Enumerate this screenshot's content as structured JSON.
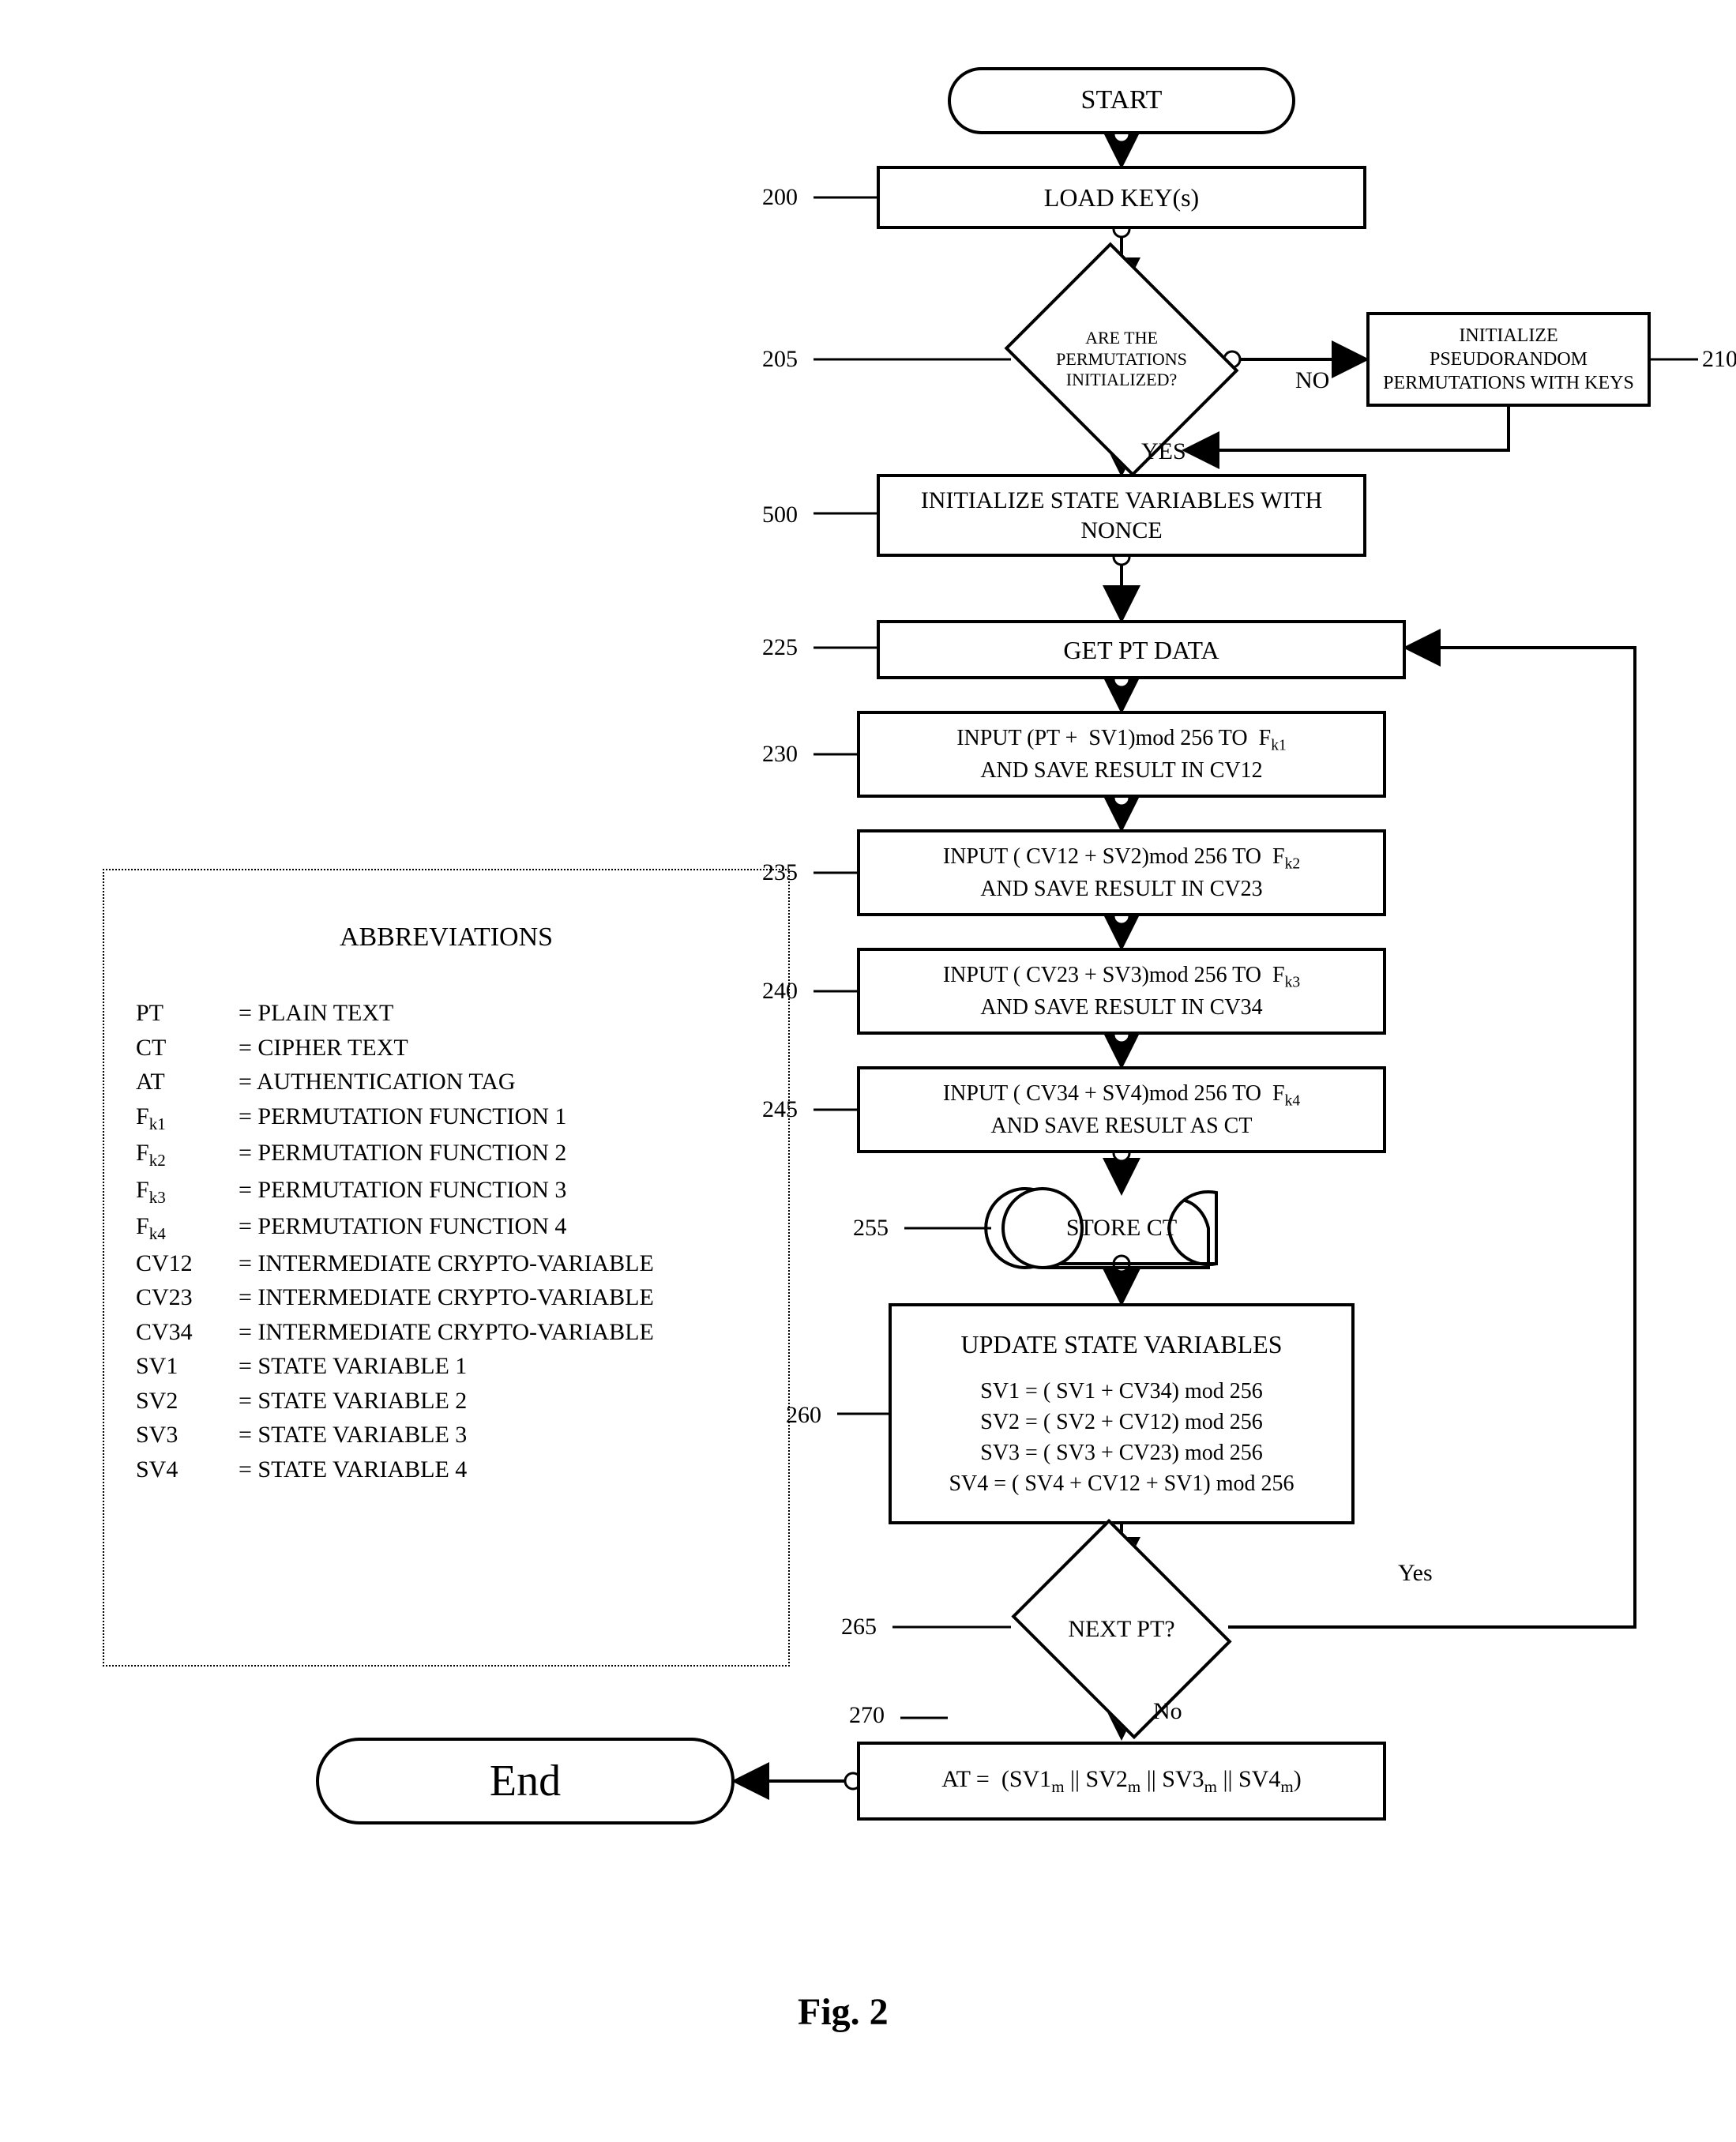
{
  "figure_label": "Fig. 2",
  "nodes": {
    "start": "START",
    "load_keys": "LOAD KEY(s)",
    "decision_perm": "ARE THE PERMUTATIONS INITIALIZED?",
    "init_perm": "INITIALIZE  PSEUDORANDOM PERMUTATIONS   WITH KEYS",
    "init_state": "INITIALIZE STATE VARIABLES WITH NONCE",
    "get_pt": "GET PT DATA",
    "step230": "INPUT (PT +  SV1)mod 256 TO  F_k1 AND SAVE RESULT IN CV12",
    "step235": "INPUT ( CV12 + SV2)mod 256 TO  F_k2 AND SAVE RESULT IN CV23",
    "step240": "INPUT ( CV23 + SV3)mod 256 TO  F_k3 AND SAVE RESULT IN CV34",
    "step245": "INPUT ( CV34 + SV4)mod 256 TO  F_k4 AND SAVE RESULT AS CT",
    "store_ct": "STORE CT",
    "update_title": "UPDATE STATE VARIABLES",
    "update_lines": [
      "SV1 = ( SV1 + CV34) mod 256",
      "SV2 = ( SV2 + CV12) mod 256",
      "SV3 = ( SV3 + CV23) mod 256",
      "SV4 = ( SV4 + CV12 + SV1) mod 256"
    ],
    "decision_next": "NEXT PT?",
    "at_eq": "AT =  (SV1_m || SV2_m || SV3_m || SV4_m)",
    "end": "End"
  },
  "refs": {
    "r200": "200",
    "r205": "205",
    "r210": "210",
    "r225": "225",
    "r230": "230",
    "r235": "235",
    "r240": "240",
    "r245": "245",
    "r255": "255",
    "r260": "260",
    "r265": "265",
    "r270": "270",
    "r500": "500"
  },
  "edge_labels": {
    "yes1": "YES",
    "no1": "NO",
    "yes2": "Yes",
    "no2": "No"
  },
  "abbrev": {
    "title": "ABBREVIATIONS",
    "rows": [
      {
        "k": "PT",
        "v": "= PLAIN TEXT"
      },
      {
        "k": "CT",
        "v": "= CIPHER TEXT"
      },
      {
        "k": "AT",
        "v": "= AUTHENTICATION TAG"
      },
      {
        "k": "F_k1",
        "v": "= PERMUTATION FUNCTION 1"
      },
      {
        "k": "F_k2",
        "v": "= PERMUTATION FUNCTION 2"
      },
      {
        "k": "F_k3",
        "v": "= PERMUTATION FUNCTION 3"
      },
      {
        "k": "F_k4",
        "v": "= PERMUTATION FUNCTION 4"
      },
      {
        "k": "CV12",
        "v": "= INTERMEDIATE CRYPTO-VARIABLE"
      },
      {
        "k": "CV23",
        "v": "= INTERMEDIATE CRYPTO-VARIABLE"
      },
      {
        "k": "CV34",
        "v": "= INTERMEDIATE CRYPTO-VARIABLE"
      },
      {
        "k": "SV1",
        "v": "= STATE VARIABLE 1"
      },
      {
        "k": "SV2",
        "v": "= STATE VARIABLE 2"
      },
      {
        "k": "SV3",
        "v": "= STATE VARIABLE 3"
      },
      {
        "k": "SV4",
        "v": "= STATE VARIABLE 4"
      }
    ]
  }
}
